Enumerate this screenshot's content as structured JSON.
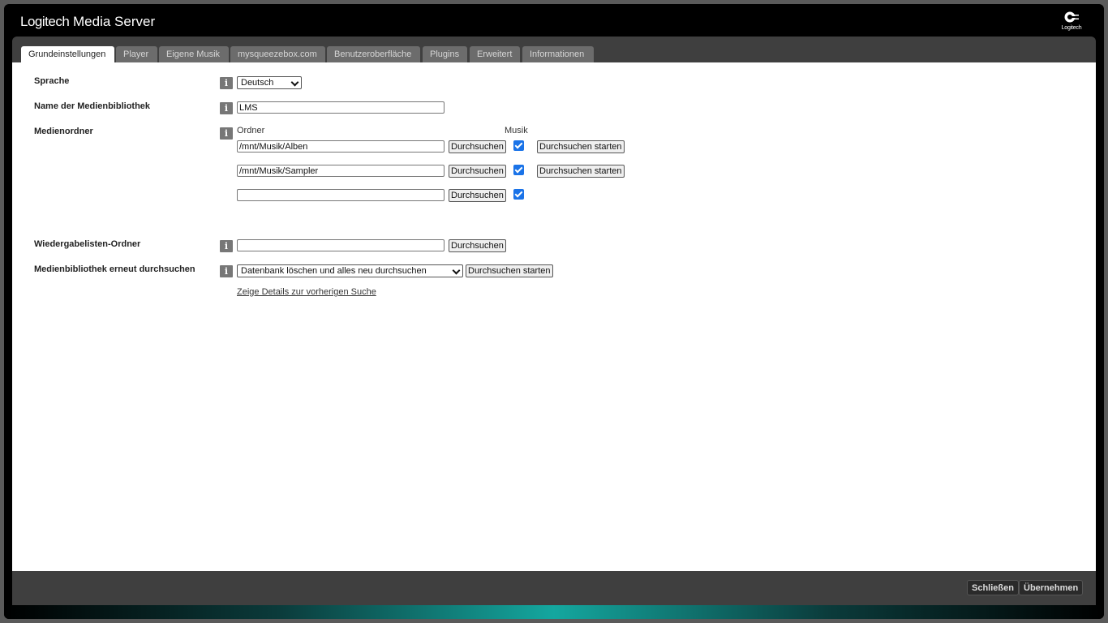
{
  "app": {
    "brand": "Logitech",
    "product": "Media Server",
    "logo_text": "Logitech"
  },
  "tabs": [
    {
      "label": "Grundeinstellungen",
      "active": true
    },
    {
      "label": "Player"
    },
    {
      "label": "Eigene Musik"
    },
    {
      "label": "mysqueezebox.com"
    },
    {
      "label": "Benutzeroberfläche"
    },
    {
      "label": "Plugins"
    },
    {
      "label": "Erweitert"
    },
    {
      "label": "Informationen"
    }
  ],
  "settings": {
    "language": {
      "label": "Sprache",
      "value": "Deutsch"
    },
    "library_name": {
      "label": "Name der Medienbibliothek",
      "value": "LMS"
    },
    "media_folders": {
      "label": "Medienordner",
      "col_folder": "Ordner",
      "col_music": "Musik",
      "rows": [
        {
          "path": "/mnt/Musik/Alben",
          "browse": "Durchsuchen",
          "scan": "Durchsuchen starten",
          "music": true
        },
        {
          "path": "/mnt/Musik/Sampler",
          "browse": "Durchsuchen",
          "scan": "Durchsuchen starten",
          "music": true
        },
        {
          "path": "",
          "browse": "Durchsuchen",
          "music": true
        }
      ]
    },
    "playlist_folder": {
      "label": "Wiedergabelisten-Ordner",
      "value": "",
      "browse": "Durchsuchen"
    },
    "rescan": {
      "label": "Medienbibliothek erneut durchsuchen",
      "option": "Datenbank löschen und alles neu durchsuchen",
      "button": "Durchsuchen starten",
      "details_link": "Zeige Details zur vorherigen Suche"
    },
    "info_icon": "i"
  },
  "footer": {
    "close": "Schließen",
    "apply": "Übernehmen"
  },
  "colors": {
    "frame": "#000000",
    "tabbar": "#3f3f3f",
    "tab_inactive": "#6c6c6c",
    "checkbox": "#1a73e8",
    "glow": "#14a79f"
  }
}
